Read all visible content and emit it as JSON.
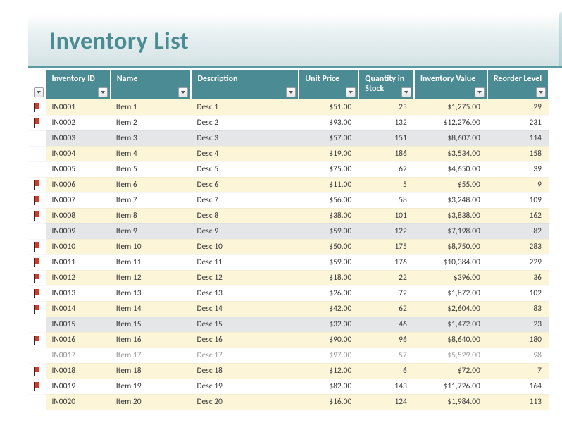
{
  "title": "Inventory List",
  "columns": [
    "Inventory ID",
    "Name",
    "Description",
    "Unit Price",
    "Quantity in Stock",
    "Inventory Value",
    "Reorder Level"
  ],
  "rows": [
    {
      "flag": true,
      "band": "cream",
      "id": "IN0001",
      "name": "Item 1",
      "desc": "Desc 1",
      "price": "$51.00",
      "qty": "25",
      "value": "$1,275.00",
      "reorder": "29"
    },
    {
      "flag": true,
      "band": "white",
      "id": "IN0002",
      "name": "Item 2",
      "desc": "Desc 2",
      "price": "$93.00",
      "qty": "132",
      "value": "$12,276.00",
      "reorder": "231"
    },
    {
      "flag": false,
      "band": "grey",
      "id": "IN0003",
      "name": "Item 3",
      "desc": "Desc 3",
      "price": "$57.00",
      "qty": "151",
      "value": "$8,607.00",
      "reorder": "114"
    },
    {
      "flag": false,
      "band": "cream",
      "id": "IN0004",
      "name": "Item 4",
      "desc": "Desc 4",
      "price": "$19.00",
      "qty": "186",
      "value": "$3,534.00",
      "reorder": "158"
    },
    {
      "flag": false,
      "band": "white",
      "id": "IN0005",
      "name": "Item 5",
      "desc": "Desc 5",
      "price": "$75.00",
      "qty": "62",
      "value": "$4,650.00",
      "reorder": "39"
    },
    {
      "flag": true,
      "band": "cream",
      "id": "IN0006",
      "name": "Item 6",
      "desc": "Desc 6",
      "price": "$11.00",
      "qty": "5",
      "value": "$55.00",
      "reorder": "9"
    },
    {
      "flag": true,
      "band": "white",
      "id": "IN0007",
      "name": "Item 7",
      "desc": "Desc 7",
      "price": "$56.00",
      "qty": "58",
      "value": "$3,248.00",
      "reorder": "109"
    },
    {
      "flag": true,
      "band": "cream",
      "id": "IN0008",
      "name": "Item 8",
      "desc": "Desc 8",
      "price": "$38.00",
      "qty": "101",
      "value": "$3,838.00",
      "reorder": "162"
    },
    {
      "flag": false,
      "band": "grey",
      "id": "IN0009",
      "name": "Item 9",
      "desc": "Desc 9",
      "price": "$59.00",
      "qty": "122",
      "value": "$7,198.00",
      "reorder": "82"
    },
    {
      "flag": true,
      "band": "cream",
      "id": "IN0010",
      "name": "Item 10",
      "desc": "Desc 10",
      "price": "$50.00",
      "qty": "175",
      "value": "$8,750.00",
      "reorder": "283"
    },
    {
      "flag": true,
      "band": "white",
      "id": "IN0011",
      "name": "Item 11",
      "desc": "Desc 11",
      "price": "$59.00",
      "qty": "176",
      "value": "$10,384.00",
      "reorder": "229"
    },
    {
      "flag": true,
      "band": "cream",
      "id": "IN0012",
      "name": "Item 12",
      "desc": "Desc 12",
      "price": "$18.00",
      "qty": "22",
      "value": "$396.00",
      "reorder": "36"
    },
    {
      "flag": true,
      "band": "white",
      "id": "IN0013",
      "name": "Item 13",
      "desc": "Desc 13",
      "price": "$26.00",
      "qty": "72",
      "value": "$1,872.00",
      "reorder": "102"
    },
    {
      "flag": true,
      "band": "cream",
      "id": "IN0014",
      "name": "Item 14",
      "desc": "Desc 14",
      "price": "$42.00",
      "qty": "62",
      "value": "$2,604.00",
      "reorder": "83"
    },
    {
      "flag": false,
      "band": "grey",
      "id": "IN0015",
      "name": "Item 15",
      "desc": "Desc 15",
      "price": "$32.00",
      "qty": "46",
      "value": "$1,472.00",
      "reorder": "23"
    },
    {
      "flag": true,
      "band": "cream",
      "id": "IN0016",
      "name": "Item 16",
      "desc": "Desc 16",
      "price": "$90.00",
      "qty": "96",
      "value": "$8,640.00",
      "reorder": "180"
    },
    {
      "flag": false,
      "band": "white",
      "strike": true,
      "id": "IN0017",
      "name": "Item 17",
      "desc": "Desc 17",
      "price": "$97.00",
      "qty": "57",
      "value": "$5,529.00",
      "reorder": "98"
    },
    {
      "flag": true,
      "band": "cream",
      "id": "IN0018",
      "name": "Item 18",
      "desc": "Desc 18",
      "price": "$12.00",
      "qty": "6",
      "value": "$72.00",
      "reorder": "7"
    },
    {
      "flag": true,
      "band": "white",
      "id": "IN0019",
      "name": "Item 19",
      "desc": "Desc 19",
      "price": "$82.00",
      "qty": "143",
      "value": "$11,726.00",
      "reorder": "164"
    },
    {
      "flag": false,
      "band": "cream",
      "id": "IN0020",
      "name": "Item 20",
      "desc": "Desc 20",
      "price": "$16.00",
      "qty": "124",
      "value": "$1,984.00",
      "reorder": "113"
    }
  ]
}
